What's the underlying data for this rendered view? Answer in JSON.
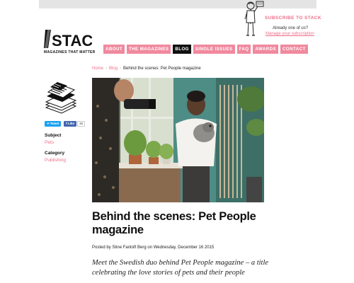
{
  "site": {
    "tagline": "MAGAZINES THAT MATTER",
    "logo_text": "STACK"
  },
  "subscribe": {
    "label": "SUBSCRIBE TO STACK",
    "already": "Already one of us?",
    "manage": "Manage your subscription"
  },
  "nav": {
    "items": [
      {
        "label": "ABOUT"
      },
      {
        "label": "THE MAGAZINES"
      },
      {
        "label": "BLOG",
        "active": true
      },
      {
        "label": "SINGLE ISSUES"
      },
      {
        "label": "FAQ"
      },
      {
        "label": "AWARDS"
      },
      {
        "label": "CONTACT"
      }
    ]
  },
  "breadcrumb": {
    "home": "Home",
    "blog": "Blog",
    "current": "Behind the scenes: Pet People magazine"
  },
  "share": {
    "tweet": "Tweet",
    "like": "Like",
    "like_count": "15"
  },
  "sidebar": {
    "subject_label": "Subject",
    "subject_value": "Pets",
    "category_label": "Category",
    "category_value": "Publishing"
  },
  "article": {
    "title": "Behind the scenes: Pet People magazine",
    "byline": "Posted by Stine Fantoft Berg on Wednesday, December 16 2015",
    "lede": "Meet the Swedish duo behind Pet People magazine – a title celebrating the love stories of pets and their people"
  },
  "colors": {
    "accent_pink": "#f0899e",
    "link_pink": "#ef6e8a",
    "nav_active": "#111111"
  },
  "icons": [
    "stack-logo-icon",
    "subscriber-illustration-icon",
    "magazine-stack-icon",
    "twitter-bird-icon",
    "facebook-icon"
  ]
}
